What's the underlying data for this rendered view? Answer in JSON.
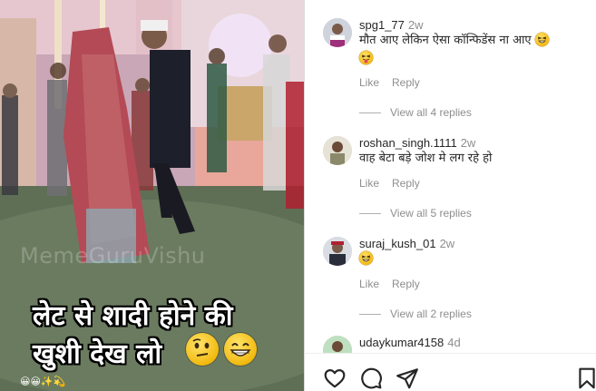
{
  "video": {
    "watermark": "MemeGuruVishu",
    "caption_line1": "लेट से शादी होने की",
    "caption_line2": "खुशी देख लो",
    "caption_emojis": [
      "thinking-face-emoji",
      "grinning-face-emoji"
    ],
    "corner_emojis": "😀😀✨💫"
  },
  "comments": [
    {
      "username": "spg1_77",
      "time": "2w",
      "text": "मौत आए लेकिन ऐसा कॉन्फिडेंस ना आए",
      "emojis": [
        "rolling-laughing-emoji",
        "tongue-face-emoji"
      ],
      "like_label": "Like",
      "reply_label": "Reply",
      "view_replies": "View all 4 replies"
    },
    {
      "username": "roshan_singh.1111",
      "time": "2w",
      "text": "वाह बेटा बड़े जोश मे लग रहे हो",
      "emojis": [],
      "like_label": "Like",
      "reply_label": "Reply",
      "view_replies": "View all 5 replies"
    },
    {
      "username": "suraj_kush_01",
      "time": "2w",
      "text": "",
      "emojis": [
        "rolling-laughing-emoji"
      ],
      "like_label": "Like",
      "reply_label": "Reply",
      "view_replies": "View all 2 replies"
    },
    {
      "username": "udaykumar4158",
      "time": "4d",
      "text": "",
      "emojis": []
    }
  ],
  "actions": {
    "icons": [
      "heart-icon",
      "comment-icon",
      "share-icon",
      "bookmark-icon"
    ]
  },
  "colors": {
    "text_primary": "#262626",
    "text_secondary": "#8e8e8e",
    "border": "#dbdbdb"
  }
}
